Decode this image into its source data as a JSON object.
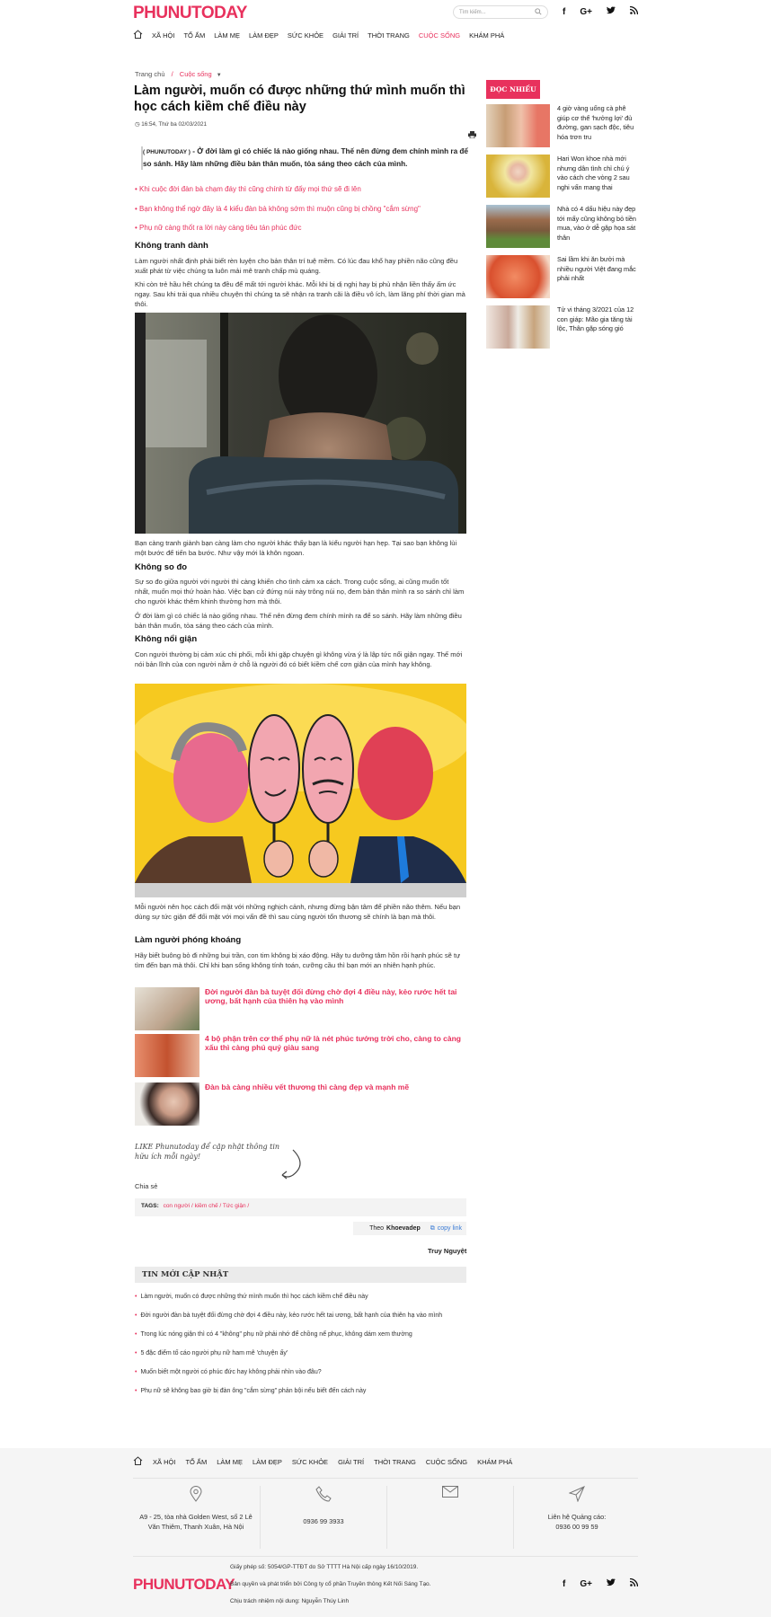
{
  "header": {
    "logo": "PHUNUTODAY",
    "search_placeholder": "Tìm kiếm...",
    "social": [
      "f",
      "G+",
      "t",
      "rss"
    ]
  },
  "nav": [
    "XÃ HỘI",
    "TỔ ẤM",
    "LÀM MẸ",
    "LÀM ĐẸP",
    "SỨC KHỎE",
    "GIẢI TRÍ",
    "THỜI TRANG",
    "CUỘC SỐNG",
    "KHÁM PHÁ"
  ],
  "breadcrumb": {
    "home": "Trang chủ",
    "sep": "/",
    "current": "Cuộc sống"
  },
  "article": {
    "title": "Làm người, muốn có được những thứ mình muốn thì học cách kiềm chế điều này",
    "date": "16:54, Thứ ba 02/03/2021",
    "sapo_prefix": "( PHUNUTODAY )",
    "sapo": " - Ở đời làm gì có chiếc lá nào giống nhau. Thế nên đừng đem chính mình ra để so sánh. Hãy làm những điều bản thân muốn, tỏa sáng theo cách của mình.",
    "links": [
      "Khi cuộc đời đàn bà chạm đáy thì cũng chính từ đấy mọi thứ sẽ đi lên",
      "Bạn không thể ngờ đây là 4 kiểu đàn bà không sớm thì muộn cũng bị chồng \"cắm sừng\"",
      "Phụ nữ càng thốt ra lời này càng tiêu tán phúc đức"
    ],
    "h1": "Không tranh dành",
    "p1": "Làm người nhất định phải biết rèn luyện cho bản thân trí tuệ mềm. Có lúc đau khổ hay phiền não cũng đều xuất phát từ việc chúng ta luôn mải mê tranh chấp mù quáng.",
    "p2": "Khi còn trẻ hầu hết chúng ta đều để mất tới người khác. Mỗi khi bị dị nghị hay bị phủ nhận liền thấy ấm ức ngay. Sau khi trải qua nhiều chuyện thì chúng ta sẽ nhận ra tranh cãi là điều vô ích, làm lãng phí thời gian mà thôi.",
    "p3": "Bạn càng tranh giành bạn càng làm cho người khác thấy bạn là kiểu người hạn hẹp. Tại sao bạn không lùi một bước để tiến ba bước. Như vậy mới là khôn ngoan.",
    "h2": "Không so đo",
    "p4": "Sự so đo giữa người với người thì càng khiến cho tình cảm xa cách. Trong cuộc sống, ai cũng muốn tốt nhất, muốn mọi thứ hoàn hảo. Việc bạn cứ đứng núi này trông núi nọ, đem bản thân mình ra so sánh chỉ làm cho người khác thêm khinh thường hơn mà thôi.",
    "p5": "Ở đời làm gì có chiếc lá nào giống nhau. Thế nên đừng đem chính mình ra để so sánh. Hãy làm những điều bản thân muốn, tỏa sáng theo cách của mình.",
    "h3": "Không nổi giận",
    "p6": "Con người thường bị cảm xúc chi phối, mỗi khi gặp chuyện gì không vừa ý là lập tức nổi giận ngay. Thế mới nói bản lĩnh của con người nằm ở chỗ là người đó có biết kiềm chế cơn giận của mình hay không.",
    "p7": "Mỗi người nên học cách đối mặt với những nghịch cảnh, nhưng đừng bận tâm để phiền não thêm. Nếu bạn dùng sự tức giận để đối mặt với mọi vấn đề thì sau cùng người tổn thương sẽ chính là bạn mà thôi.",
    "h4": "Làm người phóng khoáng",
    "p8": "Hãy biết buông bỏ đi những bụi trần, con tim không bị xáo động. Hãy tu dưỡng tâm hồn rồi hạnh phúc sẽ tự tìm đến bạn mà thôi. Chỉ khi bạn sống không tính toán, cưỡng cầu thì bạn mới an nhiên hạnh phúc.",
    "related": [
      "Đời người đàn bà tuyệt đối đừng chờ đợi 4 điều này, kẻo rước hết tai ương, bất hạnh của thiên hạ vào mình",
      "4 bộ phận trên cơ thể phụ nữ là nét phúc tướng trời cho, càng to càng xấu thì càng phú quý giàu sang",
      "Đàn bà càng nhiều vết thương thì càng đẹp và mạnh mẽ"
    ],
    "like_text": "LIKE Phunutoday để cập nhật thông tin hữu ích mỗi ngày!",
    "share": "Chia sẻ",
    "tags_label": "TAGS:",
    "tags": [
      "con người",
      "kiềm chế",
      "Tức giận"
    ],
    "source_prefix": "Theo",
    "source": "Khoevadep",
    "copy_link": "copy link",
    "author": "Truy Nguyệt"
  },
  "latest": {
    "title": "TIN MỚI CẬP NHẬT",
    "items": [
      "Làm người, muốn có được những thứ mình muốn thì học cách kiềm chế điều này",
      "Đời người đàn bà tuyệt đối đừng chờ đợi 4 điều này, kẻo rước hết tai ương, bất hạnh của thiên hạ vào mình",
      "Trong lúc nóng giận thì có 4 \"không\" phụ nữ phải nhớ để chồng nể phục, không dám xem thường",
      "5 đặc điểm tố cáo người phụ nữ ham mê 'chuyện ấy'",
      "Muốn biết một người có phúc đức hay không phải nhìn vào đâu?",
      "Phụ nữ sẽ không bao giờ bị đàn ông \"cắm sừng\" phản bội nếu biết đến cách này"
    ]
  },
  "sidebar": {
    "title": "ĐỌC NHIỀU",
    "items": [
      "4 giờ vàng uống cà phê giúp cơ thể 'hưởng lợi' đủ đường, gan sạch độc, tiêu hóa trơn tru",
      "Hari Won khoe nhà mới nhưng dân tình chỉ chú ý vào cách che vòng 2 sau nghi vấn mang thai",
      "Nhà có 4 dấu hiệu này đẹp tới mấy cũng không bỏ tiền mua, vào ở dễ gặp họa sát thân",
      "Sai lầm khi ăn bưởi mà nhiều người Việt đang mắc phải nhất",
      "Tử vi tháng 3/2021 của 12 con giáp: Mão gia tăng tài lộc, Thân gặp sóng gió"
    ]
  },
  "footer": {
    "address": "A9 - 25, tòa nhà Golden West, số 2 Lê Văn Thiêm, Thanh Xuân, Hà Nội",
    "phone": "0936 99 3933",
    "ads_label": "Liên hệ Quảng cáo:",
    "ads_phone": "0936 00 99 59",
    "license": "Giấy phép số: 5054/GP-TTĐT do Sở TTTT Hà Nội cấp ngày 16/10/2019.",
    "copyright": "Bản quyền và phát triển bởi Công ty cổ phần Truyền thông Kết Nối Sáng Tạo.",
    "editor": "Chịu trách nhiệm nội dung: Nguyễn Thúy Linh"
  },
  "colors": {
    "accent": "#e8315d",
    "footer_bg": "#f5f5f5",
    "sidebar_title_bg": "#e8315d"
  }
}
